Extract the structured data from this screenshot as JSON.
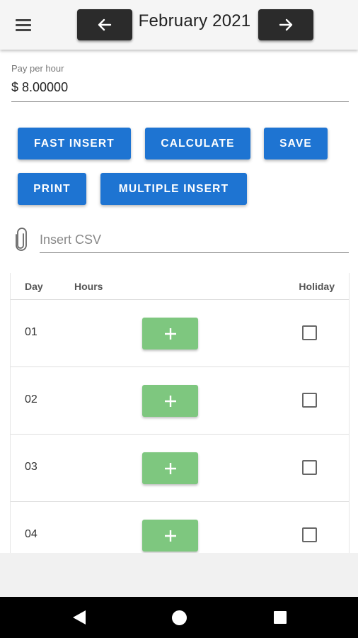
{
  "header": {
    "month_title": "February 2021",
    "prev_icon": "arrow-left-icon",
    "next_icon": "arrow-right-icon",
    "menu_icon": "hamburger-menu-icon"
  },
  "pay": {
    "label": "Pay per hour",
    "value": "$ 8.00000"
  },
  "actions": {
    "fast_insert": "FAST INSERT",
    "calculate": "CALCULATE",
    "save": "SAVE",
    "print": "PRINT",
    "multiple_insert": "MULTIPLE INSERT"
  },
  "csv": {
    "placeholder": "Insert CSV",
    "icon": "paperclip-icon"
  },
  "table": {
    "headers": {
      "day": "Day",
      "hours": "Hours",
      "holiday": "Holiday"
    },
    "rows": [
      {
        "day": "01",
        "holiday": false
      },
      {
        "day": "02",
        "holiday": false
      },
      {
        "day": "03",
        "holiday": false
      },
      {
        "day": "04",
        "holiday": false
      }
    ],
    "add_icon": "plus-icon"
  },
  "colors": {
    "primary": "#1e74d2",
    "add_button": "#7ec77f",
    "nav_button": "#2b2b2b"
  }
}
